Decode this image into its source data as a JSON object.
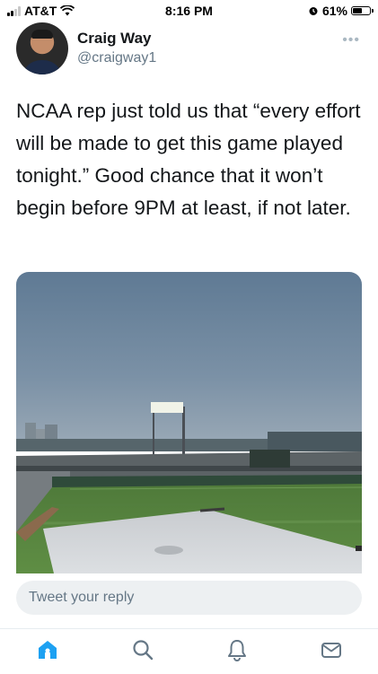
{
  "status_bar": {
    "carrier": "AT&T",
    "time": "8:16 PM",
    "battery_percent": "61%",
    "battery_level": 0.61,
    "icons": [
      "signal-icon",
      "wifi-icon",
      "alarm-icon",
      "battery-icon"
    ]
  },
  "tweet": {
    "display_name": "Craig Way",
    "handle": "@craigway1",
    "text": "NCAA rep just told us that “every effort will be made to get this game played tonight.”  Good chance that it won’t begin before 9PM at least, if not later.",
    "more_icon": "more-dots-icon"
  },
  "reply": {
    "placeholder": "Tweet your reply"
  },
  "tab_bar": {
    "tabs": [
      "home-icon",
      "search-icon",
      "notifications-icon",
      "messages-icon"
    ],
    "active_color": "#1da1f2",
    "inactive_color": "#657786"
  },
  "colors": {
    "accent": "#1da1f2",
    "secondary_text": "#657786"
  }
}
